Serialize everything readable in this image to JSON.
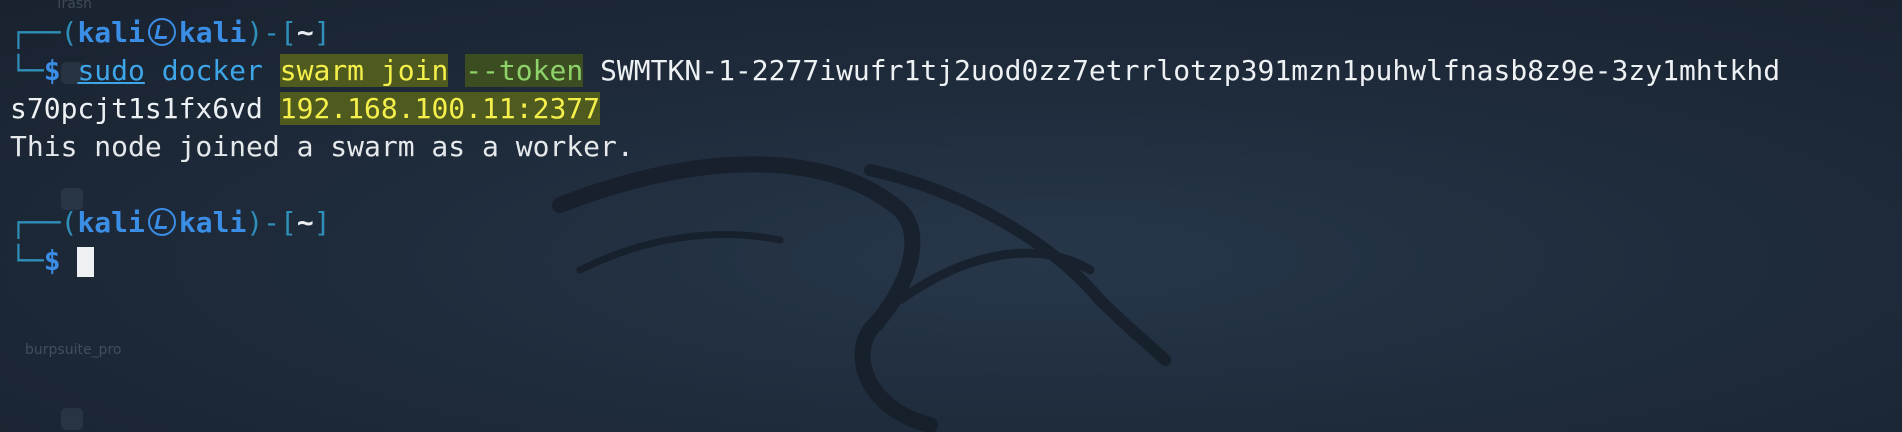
{
  "desktop": {
    "icons": [
      {
        "label": "Trash",
        "icon": "trash-icon"
      },
      {
        "label": "burpsuite_pro",
        "icon": "burpsuite-icon"
      }
    ]
  },
  "terminal": {
    "prompt": {
      "user": "kali",
      "host": "kali",
      "cwd": "~",
      "symbol": "$"
    },
    "command": {
      "sudo": "sudo",
      "binary": "docker",
      "subcommand": "swarm join",
      "option": "--token",
      "token_part1": "SWMTKN-1-2277iwufr1tj2uod0zz7etrrlotzp391mzn1puhwlfnasb8z9e-3zy1mhtkhd",
      "token_part2": "s70pcjt1s1fx6vd",
      "address": "192.168.100.11:2377"
    },
    "output": "This node joined a swarm as a worker."
  },
  "colors": {
    "background": "#1f2c3c",
    "prompt_frame": "#2f8fb8",
    "prompt_user": "#3b8ee6",
    "command": "#3da5e8",
    "highlight_bg": "#4f5a1e",
    "highlight_fg": "#f4ef4a",
    "option_fg": "#8ed26a"
  }
}
